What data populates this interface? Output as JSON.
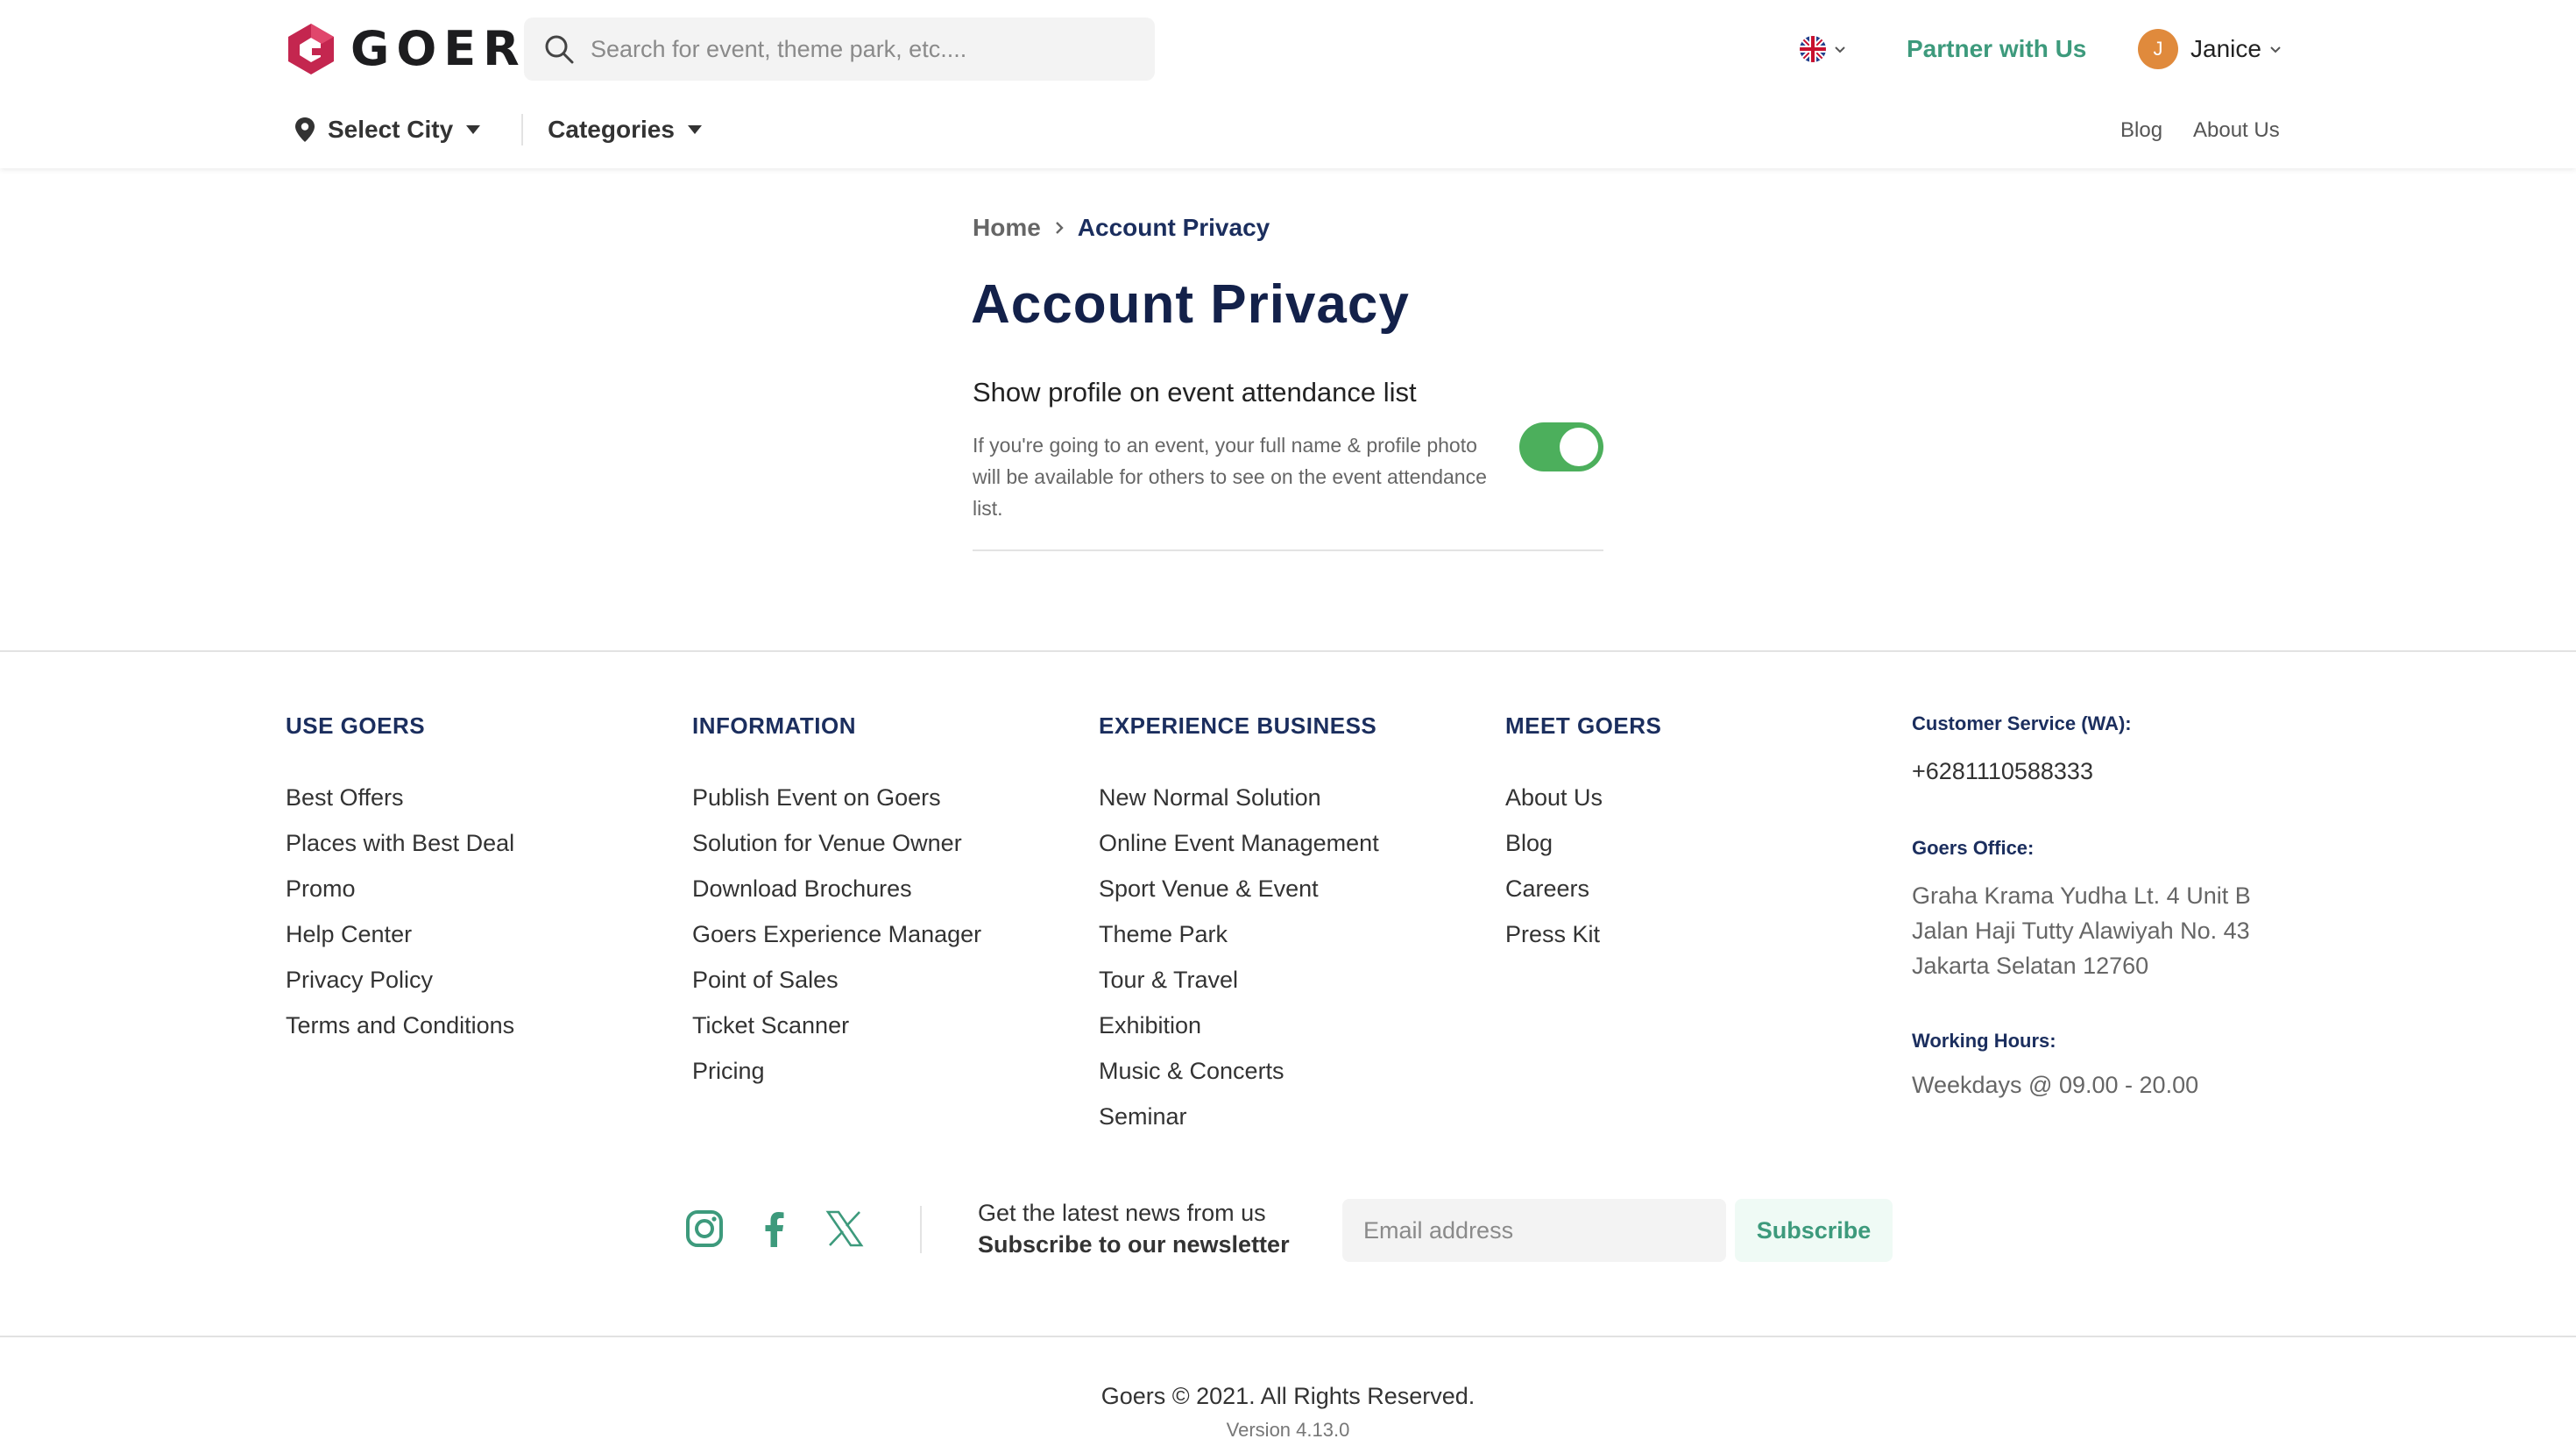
{
  "header": {
    "logo_text": "GOERS",
    "search_placeholder": "Search for event, theme park, etc....",
    "partner_label": "Partner with Us",
    "user": {
      "initial": "J",
      "name": "Janice"
    },
    "language_icon": "uk-flag-icon",
    "subnav": {
      "city_label": "Select City",
      "categories_label": "Categories",
      "blog_label": "Blog",
      "about_label": "About Us"
    }
  },
  "breadcrumb": {
    "home": "Home",
    "current": "Account Privacy"
  },
  "page_title": "Account Privacy",
  "setting": {
    "title": "Show profile on event attendance list",
    "description": "If you're going to an event, your full name & profile photo will be available for others to see on the event attendance list.",
    "enabled": true,
    "toggle_color": "#4caf5c"
  },
  "footer": {
    "columns": [
      {
        "title": "USE GOERS",
        "items": [
          "Best Offers",
          "Places with Best Deal",
          "Promo",
          "Help Center",
          "Privacy Policy",
          "Terms and Conditions"
        ]
      },
      {
        "title": "INFORMATION",
        "items": [
          "Publish Event on Goers",
          "Solution for Venue Owner",
          "Download Brochures",
          "Goers Experience Manager",
          "Point of Sales",
          "Ticket Scanner",
          "Pricing"
        ]
      },
      {
        "title": "EXPERIENCE BUSINESS",
        "items": [
          "New Normal Solution",
          "Online Event Management",
          "Sport Venue & Event",
          "Theme Park",
          "Tour & Travel",
          "Exhibition",
          "Music & Concerts",
          "Seminar"
        ]
      },
      {
        "title": "MEET GOERS",
        "items": [
          "About Us",
          "Blog",
          "Careers",
          "Press Kit"
        ]
      }
    ],
    "contact": {
      "cs_label": "Customer Service (WA):",
      "cs_phone": "+6281110588333",
      "office_label": "Goers Office:",
      "office_lines": [
        "Graha Krama Yudha Lt. 4 Unit B",
        "Jalan Haji Tutty Alawiyah No. 43",
        "Jakarta Selatan 12760"
      ],
      "hours_label": "Working Hours:",
      "hours_value": "Weekdays @ 09.00 - 20.00"
    },
    "social_icons": [
      "instagram-icon",
      "facebook-icon",
      "x-icon"
    ],
    "newsletter": {
      "line1": "Get the latest news from us",
      "line2": "Subscribe to our newsletter",
      "email_placeholder": "Email address",
      "subscribe_label": "Subscribe"
    },
    "copyright": "Goers © 2021. All Rights Reserved.",
    "version": "Version 4.13.0"
  },
  "colors": {
    "brand_green": "#3d9a7c",
    "brand_navy": "#1b2e5e",
    "logo_red": "#c4264f",
    "avatar_orange": "#e08a3c"
  }
}
